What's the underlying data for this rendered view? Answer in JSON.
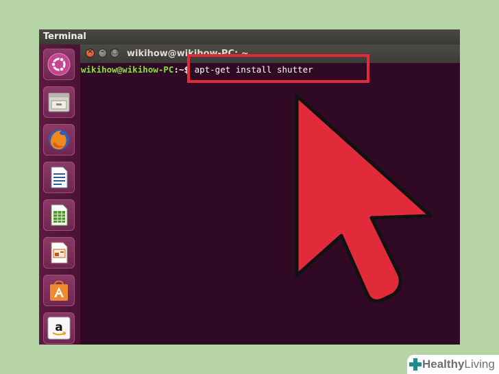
{
  "topbar": {
    "title": "Terminal"
  },
  "window": {
    "title": "wikihow@wikihow-PC: ~"
  },
  "terminal": {
    "user_host": "wikihow@wikihow-PC",
    "path_sep": ":~$ ",
    "command": "apt-get install shutter"
  },
  "launcher": {
    "items": [
      {
        "icon": "ubuntu-dash-icon"
      },
      {
        "icon": "files-icon"
      },
      {
        "icon": "firefox-icon"
      },
      {
        "icon": "libreoffice-writer-icon"
      },
      {
        "icon": "libreoffice-calc-icon"
      },
      {
        "icon": "libreoffice-impress-icon"
      },
      {
        "icon": "software-center-icon"
      },
      {
        "icon": "amazon-icon"
      }
    ]
  },
  "annotation": {
    "highlight_color": "#e12a3a",
    "arrow_color": "#e12a3a"
  },
  "watermark": {
    "brand": "Healthy",
    "brand_light": "Living"
  }
}
